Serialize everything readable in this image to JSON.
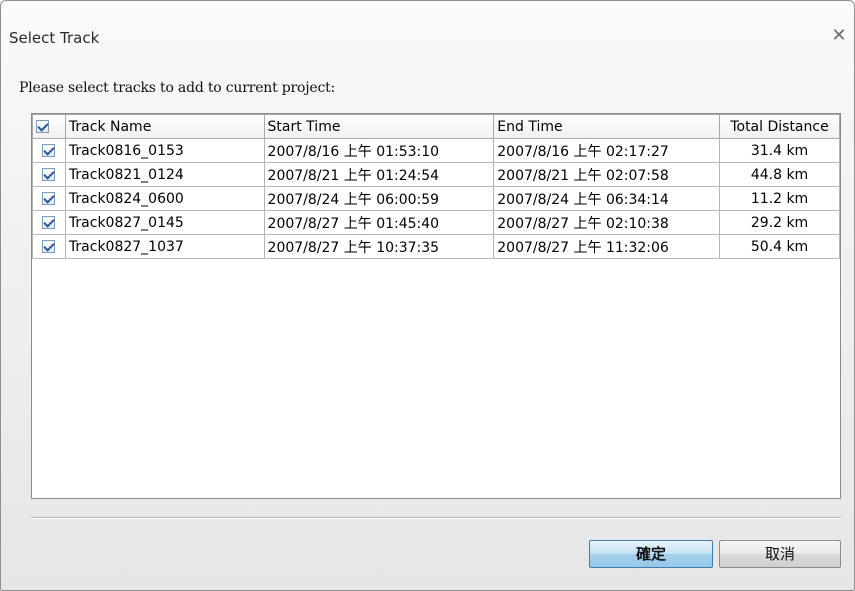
{
  "window": {
    "title": "Select Track",
    "close_glyph": "✕"
  },
  "prompt": "Please select tracks to add to current project:",
  "table": {
    "headers": {
      "name": "Track Name",
      "start": "Start Time",
      "end": "End Time",
      "distance": "Total Distance"
    },
    "header_checked": true,
    "rows": [
      {
        "checked": true,
        "name": "Track0816_0153",
        "start": "2007/8/16 上午 01:53:10",
        "end": "2007/8/16 上午 02:17:27",
        "distance": "31.4 km"
      },
      {
        "checked": true,
        "name": "Track0821_0124",
        "start": "2007/8/21 上午 01:24:54",
        "end": "2007/8/21 上午 02:07:58",
        "distance": "44.8 km"
      },
      {
        "checked": true,
        "name": "Track0824_0600",
        "start": "2007/8/24 上午 06:00:59",
        "end": "2007/8/24 上午 06:34:14",
        "distance": "11.2 km"
      },
      {
        "checked": true,
        "name": "Track0827_0145",
        "start": "2007/8/27 上午 01:45:40",
        "end": "2007/8/27 上午 02:10:38",
        "distance": "29.2 km"
      },
      {
        "checked": true,
        "name": "Track0827_1037",
        "start": "2007/8/27 上午 10:37:35",
        "end": "2007/8/27 上午 11:32:06",
        "distance": "50.4 km"
      }
    ]
  },
  "buttons": {
    "ok_label": "確定",
    "cancel_label": "取消"
  },
  "colors": {
    "ok_accent": "#97c7e9",
    "checkmark": "#215a99"
  }
}
